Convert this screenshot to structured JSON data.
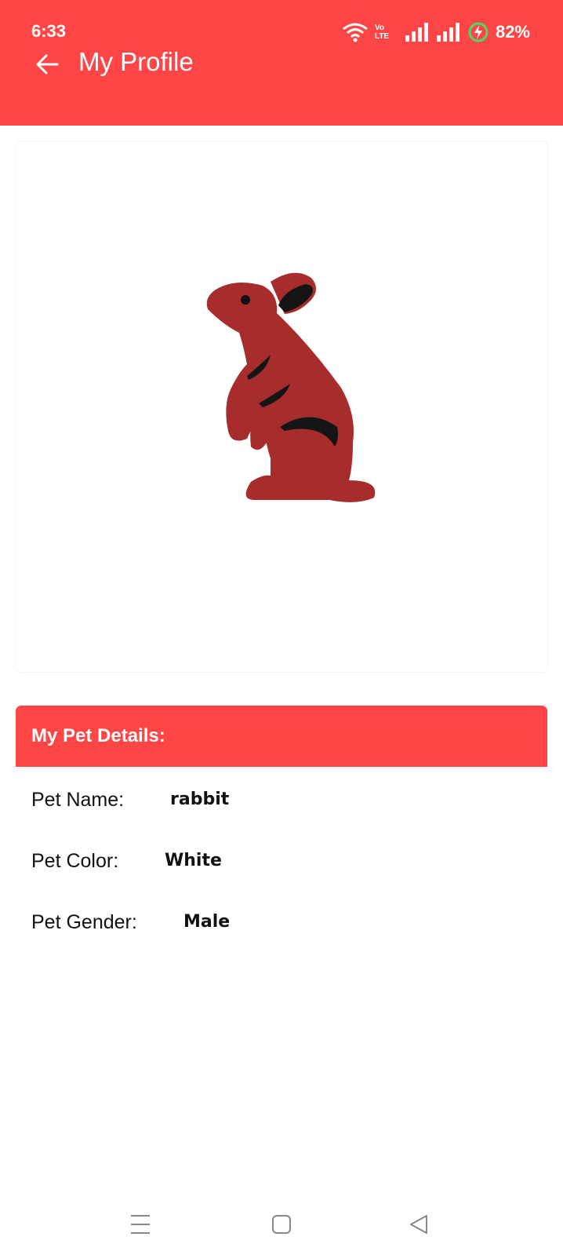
{
  "status_bar": {
    "time": "6:33",
    "network_label": "Vo LTE",
    "battery": "82%"
  },
  "app_bar": {
    "title": "My Profile",
    "back_icon": "arrow-left-icon",
    "color": "#ff4545"
  },
  "pet_photo": {
    "icon": "rabbit-illustration"
  },
  "details": {
    "header": "My Pet Details:",
    "rows": [
      {
        "label": "Pet Name:",
        "value": "rabbit"
      },
      {
        "label": "Pet Color:",
        "value": "White"
      },
      {
        "label": "Pet Gender:",
        "value": "Male"
      }
    ]
  },
  "nav_bar": {
    "icons": [
      "menu-icon",
      "home-icon",
      "back-triangle-icon"
    ]
  }
}
